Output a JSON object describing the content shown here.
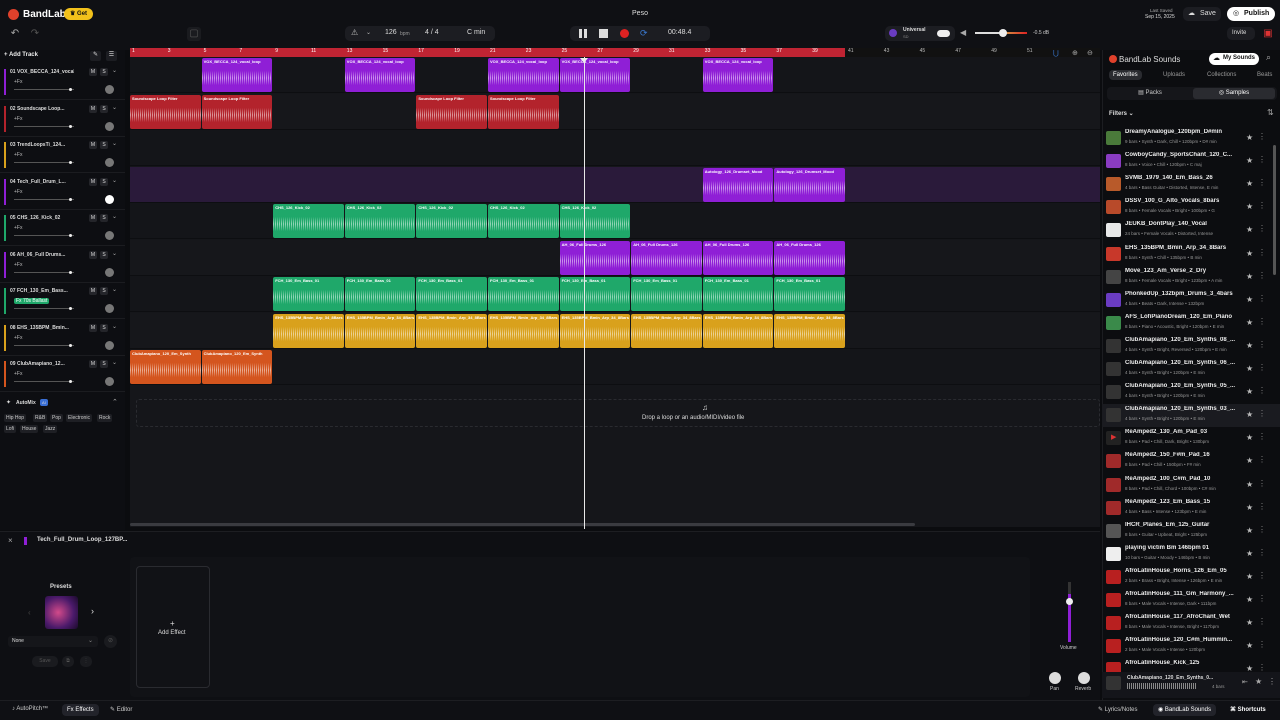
{
  "app": {
    "logo": "BandLab",
    "get_label": "Get",
    "song_title": "Peso",
    "last_saved_label": "Last Saved",
    "last_saved_date": "Sep 15, 2025",
    "save_label": "Save",
    "publish_label": "Publish",
    "invite_label": "Invite"
  },
  "toolbar": {
    "bpm": "126",
    "bpm_unit": "bpm",
    "time_sig": "4 / 4",
    "key": "C min",
    "time": "00:48.4",
    "preset_name": "Universal",
    "preset_sub": "SD",
    "volume_db": "-0.5 dB"
  },
  "colors": {
    "accent": "#c02433",
    "purple": "#8f1fd6",
    "red": "#b3232c",
    "green": "#1fa86a",
    "yellow": "#d9a11c",
    "orange": "#d4551e"
  },
  "ruler": {
    "bars": [
      "1",
      "3",
      "5",
      "7",
      "9",
      "11",
      "13",
      "15",
      "17",
      "19",
      "21",
      "23",
      "25",
      "27",
      "29",
      "31",
      "33",
      "35",
      "37",
      "39",
      "41",
      "43",
      "45",
      "47",
      "49",
      "51"
    ]
  },
  "tracks": [
    {
      "num": "01",
      "name": "VOX_BECCA_124_vocal_loop...",
      "fx": "+Fx",
      "clips": [
        {
          "name": "VOX_BECCA_124_vocal_loop",
          "start": 2,
          "end": 4
        },
        {
          "name": "VOX_BECCA_124_vocal_loop",
          "start": 6,
          "end": 8
        },
        {
          "name": "VOX_BECCA_124_vocal_loop",
          "start": 10,
          "end": 14
        },
        {
          "name": "VOX_BECCA_124_vocal_loop",
          "start": 16,
          "end": 18
        }
      ]
    },
    {
      "num": "02",
      "name": "Soundscape Loop...",
      "fx": "+Fx",
      "clips": [
        {
          "name": "Soundscape Loop Filter",
          "start": 0,
          "end": 4
        },
        {
          "name": "Soundscape Loop Filter",
          "start": 8,
          "end": 12
        }
      ]
    },
    {
      "num": "03",
      "name": "TrendLoopsTi_124...",
      "fx": "+Fx",
      "clips": []
    },
    {
      "num": "04",
      "name": "Tech_Full_Drum_L...",
      "fx": "+Fx",
      "clips": [
        {
          "name": "Autology_126_Drumset_Mood",
          "start": 16,
          "end": 20
        }
      ]
    },
    {
      "num": "05",
      "name": "CHS_126_Kick_02",
      "fx": "+Fx",
      "clips": [
        {
          "name": "CHS_126_Kick_02",
          "start": 4,
          "end": 14
        }
      ]
    },
    {
      "num": "06",
      "name": "AH_06_Full Drums...",
      "fx": "+Fx",
      "clips": [
        {
          "name": "AH_06_Full Drums_126",
          "start": 12,
          "end": 20
        }
      ]
    },
    {
      "num": "07",
      "name": "FCH_130_Em_Bass...",
      "fx": "Fx 70s Ballast",
      "clips": [
        {
          "name": "FCH_130_Em_Bass_01",
          "start": 4,
          "end": 20
        }
      ]
    },
    {
      "num": "08",
      "name": "EHS_135BPM_Bmin...",
      "fx": "+Fx",
      "clips": [
        {
          "name": "EHS_135BPM_Bmin_Arp_34_8Bars",
          "start": 4,
          "end": 20
        }
      ]
    },
    {
      "num": "09",
      "name": "ClubAmapiano_12...",
      "fx": "+Fx",
      "clips": [
        {
          "name": "ClubAmapiano_120_Em_Synth",
          "start": 0,
          "end": 4
        }
      ]
    }
  ],
  "automix": {
    "label": "AutoMix",
    "badge": "AI",
    "genres": [
      "Hip Hop",
      "R&B",
      "Pop",
      "Electronic",
      "Rock",
      "Lofi",
      "House",
      "Jazz"
    ]
  },
  "add_track_label": "Add Track",
  "drop_hint": "Drop a loop or an audio/MIDI/video file",
  "bottom": {
    "track_name": "Tech_Full_Drum_Loop_127BP...",
    "presets_label": "Presets",
    "preset_value": "None",
    "save_label": "Save",
    "add_effect_label": "Add Effect",
    "volume_label": "Volume",
    "pan_label": "Pan",
    "reverb_label": "Reverb"
  },
  "sounds": {
    "title": "BandLab Sounds",
    "my_sounds": "My Sounds",
    "tabs": [
      "Favorites",
      "Uploads",
      "Collections",
      "Beats"
    ],
    "subtabs": [
      "Packs",
      "Samples"
    ],
    "filters_label": "Filters",
    "items": [
      {
        "name": "DreamyAnalogue_120bpm_D#min",
        "meta": "9 bars • Synth • Dark, Chill • 120bpm • D# min",
        "color": "#4a7a3a"
      },
      {
        "name": "CowboyCandy_SportsChant_120_C...",
        "meta": "8 bars • Voice • Chill • 120bpm • C maj",
        "color": "#8a3cc2"
      },
      {
        "name": "SVMB_1979_140_Em_Bass_26",
        "meta": "4 bars • Bass Guitar • Distorted, Intense, E min",
        "color": "#b85a2a"
      },
      {
        "name": "DSSV_100_G_Alto_Vocals_8bars",
        "meta": "8 bars • Female Vocals • Bright • 100bpm • G",
        "color": "#b84a2a"
      },
      {
        "name": "JEUKB_DontPlay_140_Vocal",
        "meta": "24 bars • Female Vocals • Distorted, Intense",
        "color": "#e8e8e8"
      },
      {
        "name": "EHS_135BPM_Bmin_Arp_34_8Bars",
        "meta": "8 bars • Synth • Chill • 135bpm • B min",
        "color": "#c8382a"
      },
      {
        "name": "Move_123_Am_Verse_2_Dry",
        "meta": "8 bars • Female Vocals • Bright • 123bpm • A min",
        "color": "#444"
      },
      {
        "name": "PhonkedUp_132bpm_Drums_3_4bars",
        "meta": "4 bars • Beats • Dark, Intense • 132bpm",
        "color": "#6a3cc2"
      },
      {
        "name": "AFS_LofiPianoDream_120_Em_Piano",
        "meta": "8 bars • Piano • Acoustic, Bright • 120bpm • E min",
        "color": "#3a8a4a"
      },
      {
        "name": "ClubAmapiano_120_Em_Synths_08_...",
        "meta": "4 bars • Synth • Bright, Reversed • 120bpm • E min",
        "color": "#333"
      },
      {
        "name": "ClubAmapiano_120_Em_Synths_06_...",
        "meta": "4 bars • Synth • Bright • 120bpm • E min",
        "color": "#333"
      },
      {
        "name": "ClubAmapiano_120_Em_Synths_05_...",
        "meta": "4 bars • Synth • Bright • 120bpm • E min",
        "color": "#333"
      },
      {
        "name": "ClubAmapiano_120_Em_Synths_03_...",
        "meta": "4 bars • Synth • Bright • 120bpm • E min",
        "color": "#333"
      },
      {
        "name": "ReAmped2_130_Am_Pad_03",
        "meta": "8 bars • Pad • Chill, Dark, Bright • 130bpm",
        "color": "#222"
      },
      {
        "name": "ReAmped2_150_F#m_Pad_16",
        "meta": "8 bars • Pad • Chill • 150bpm • F# min",
        "color": "#a02a2a"
      },
      {
        "name": "ReAmped2_100_C#m_Pad_10",
        "meta": "8 bars • Pad • Chill, Chord • 100bpm • C# min",
        "color": "#a02a2a"
      },
      {
        "name": "ReAmped2_123_Em_Bass_15",
        "meta": "4 bars • Bass • Intense • 123bpm • E min",
        "color": "#a02a2a"
      },
      {
        "name": "IHCR_Planes_Em_125_Guitar",
        "meta": "8 bars • Guitar • Upbeat, Bright • 125bpm",
        "color": "#555"
      },
      {
        "name": "playing victim Bm 146bpm 01",
        "meta": "10 bars • Guitar • Moody • 146bpm • B min",
        "color": "#eee"
      },
      {
        "name": "AfroLatinHouse_Horns_126_Em_05",
        "meta": "2 bars • Brass • Bright, Intense • 126bpm • E min",
        "color": "#b82020"
      },
      {
        "name": "AfroLatinHouse_111_Gm_Harmony_...",
        "meta": "8 bars • Male Vocals • Intense, Dark • 111bpm",
        "color": "#b82020"
      },
      {
        "name": "AfroLatinHouse_117_AfroChant_Wet",
        "meta": "8 bars • Male Vocals • Intense, Bright • 117bpm",
        "color": "#b82020"
      },
      {
        "name": "AfroLatinHouse_120_C#m_Hummin...",
        "meta": "2 bars • Male Vocals • Intense • 120bpm",
        "color": "#b82020"
      },
      {
        "name": "AfroLatinHouse_Kick_125",
        "meta": "",
        "color": "#b82020"
      }
    ],
    "player_name": "ClubAmapiano_120_Em_Synths_0...",
    "player_meta": "4 bars"
  },
  "status": {
    "autopitch": "AutoPitch™",
    "effects": "Effects",
    "editor": "Editor",
    "lyrics": "Lyrics/Notes",
    "bandlab_sounds": "BandLab Sounds",
    "shortcuts": "Shortcuts"
  }
}
